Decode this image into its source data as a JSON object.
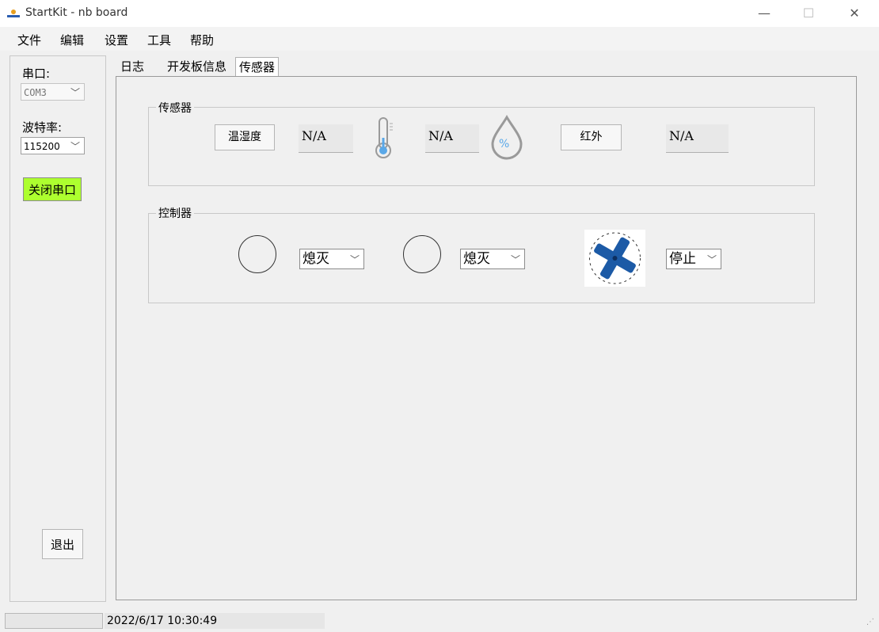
{
  "window": {
    "title": "StartKit - nb board",
    "minimize": "—",
    "maximize": "☐",
    "close": "✕"
  },
  "menu": [
    "文件",
    "编辑",
    "设置",
    "工具",
    "帮助"
  ],
  "left_panel": {
    "port_label": "串口:",
    "port_value": "COM3",
    "baud_label": "波特率:",
    "baud_value": "115200",
    "close_port_button": "关闭串口",
    "exit_button": "退出"
  },
  "tabs": [
    "日志",
    "开发板信息",
    "传感器"
  ],
  "active_tab": "传感器",
  "sensor_group": {
    "title": "传感器",
    "temp_humidity_button": "温湿度",
    "temperature_value": "N/A",
    "humidity_value": "N/A",
    "infrared_button": "红外",
    "infrared_value": "N/A",
    "humidity_icon_text": "%"
  },
  "control_group": {
    "title": "控制器",
    "lamp1_state": "熄灭",
    "lamp2_state": "熄灭",
    "fan_state": "停止"
  },
  "status": {
    "datetime": "2022/6/17 10:30:49"
  },
  "colors": {
    "close_port_bg": "#adff2f",
    "fan_blue": "#1c5aa6",
    "drop_blue": "#5aa8e8"
  }
}
